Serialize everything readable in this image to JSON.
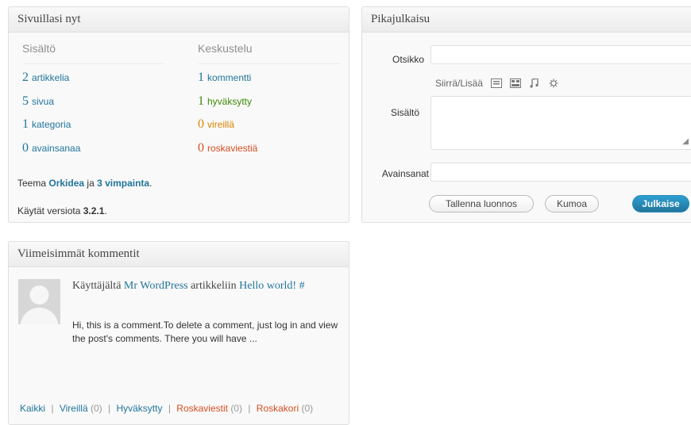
{
  "right_now": {
    "title": "Sivuillasi nyt",
    "content_heading": "Sisältö",
    "discussion_heading": "Keskustelu",
    "content": [
      {
        "num": "2",
        "label": "artikkelia"
      },
      {
        "num": "5",
        "label": "sivua"
      },
      {
        "num": "1",
        "label": "kategoria"
      },
      {
        "num": "0",
        "label": "avainsanaa"
      }
    ],
    "discussion": [
      {
        "num": "1",
        "label": "kommentti"
      },
      {
        "num": "1",
        "label": "hyväksytty"
      },
      {
        "num": "0",
        "label": "vireillä"
      },
      {
        "num": "0",
        "label": "roskaviestiä"
      }
    ],
    "theme_prefix": "Teema ",
    "theme_name": "Orkidea",
    "theme_mid": " ja ",
    "widgets": "3 vimpainta",
    "theme_suffix": ".",
    "version_prefix": "Käytät versiota ",
    "version": "3.2.1",
    "version_suffix": "."
  },
  "quickpress": {
    "title": "Pikajulkaisu",
    "title_label": "Otsikko",
    "upload_label": "Siirrä/Lisää",
    "content_label": "Sisältö",
    "tags_label": "Avainsanat",
    "save_draft": "Tallenna luonnos",
    "cancel": "Kumoa",
    "publish": "Julkaise",
    "title_value": "",
    "content_value": "",
    "tags_value": ""
  },
  "recent_comments": {
    "title": "Viimeisimmät kommentit",
    "prefix": "Käyttäjältä ",
    "author": "Mr WordPress",
    "mid": " artikkeliin ",
    "post": "Hello world!",
    "hash": " #",
    "excerpt": "Hi, this is a comment.To delete a comment, just log in and view the post's comments. There you will have ...",
    "links": {
      "all": "Kaikki",
      "pending": "Vireillä",
      "pending_count": "(0)",
      "approved": "Hyväksytty",
      "spam": "Roskaviestit",
      "spam_count": "(0)",
      "trash": "Roskakori",
      "trash_count": "(0)",
      "separator": "|"
    }
  },
  "colors": {
    "link": "#21759b",
    "approved": "#3d8a06",
    "pending": "#d98500",
    "spam": "#d54e21",
    "primary_button": "#21759b"
  }
}
